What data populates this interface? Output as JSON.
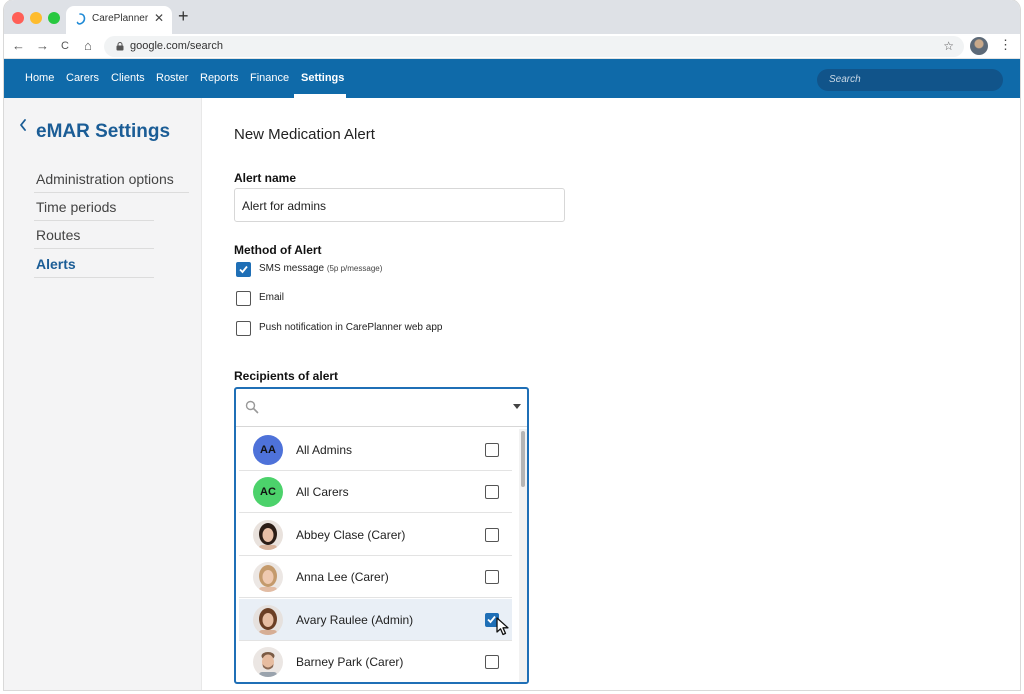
{
  "browser": {
    "tab_title": "CarePlanner",
    "tab_close": "✕",
    "new_tab": "+",
    "url": "google.com/search",
    "back": "←",
    "forward": "→",
    "reload": "C",
    "home": "⌂",
    "bookmark": "☆",
    "menu": "⋮"
  },
  "nav": {
    "items": [
      "Home",
      "Carers",
      "Clients",
      "Roster",
      "Reports",
      "Finance",
      "Settings"
    ],
    "active": "Settings",
    "search_placeholder": "Search"
  },
  "sidebar": {
    "title": "eMAR Settings",
    "items": [
      "Administration options",
      "Time periods",
      "Routes",
      "Alerts"
    ],
    "active": "Alerts"
  },
  "form": {
    "title": "New Medication Alert",
    "alert_name_label": "Alert name",
    "alert_name_value": "Alert for admins",
    "method_label": "Method of Alert",
    "methods": [
      {
        "label": "SMS message",
        "note": "(5p p/message)",
        "checked": true
      },
      {
        "label": "Email",
        "note": "",
        "checked": false
      },
      {
        "label": "Push notification in CarePlanner web app",
        "note": "",
        "checked": false
      }
    ],
    "recipients_label": "Recipients of alert",
    "recipients_search_value": ""
  },
  "recipients": [
    {
      "name": "All Admins",
      "initials": "AA",
      "avatar_color": "#4e72d9",
      "checked": false
    },
    {
      "name": "All Carers",
      "initials": "AC",
      "avatar_color": "#4cd26b",
      "checked": false
    },
    {
      "name": "Abbey Clase (Carer)",
      "initials": "",
      "avatar_color": "",
      "checked": false
    },
    {
      "name": "Anna Lee (Carer)",
      "initials": "",
      "avatar_color": "",
      "checked": false
    },
    {
      "name": "Avary Raulee (Admin)",
      "initials": "",
      "avatar_color": "",
      "checked": true,
      "highlighted": true
    },
    {
      "name": "Barney Park  (Carer)",
      "initials": "",
      "avatar_color": "",
      "checked": false
    }
  ],
  "colors": {
    "brand": "#0f6aa9",
    "accent": "#1b5d96",
    "checkbox": "#1f6fb6"
  }
}
